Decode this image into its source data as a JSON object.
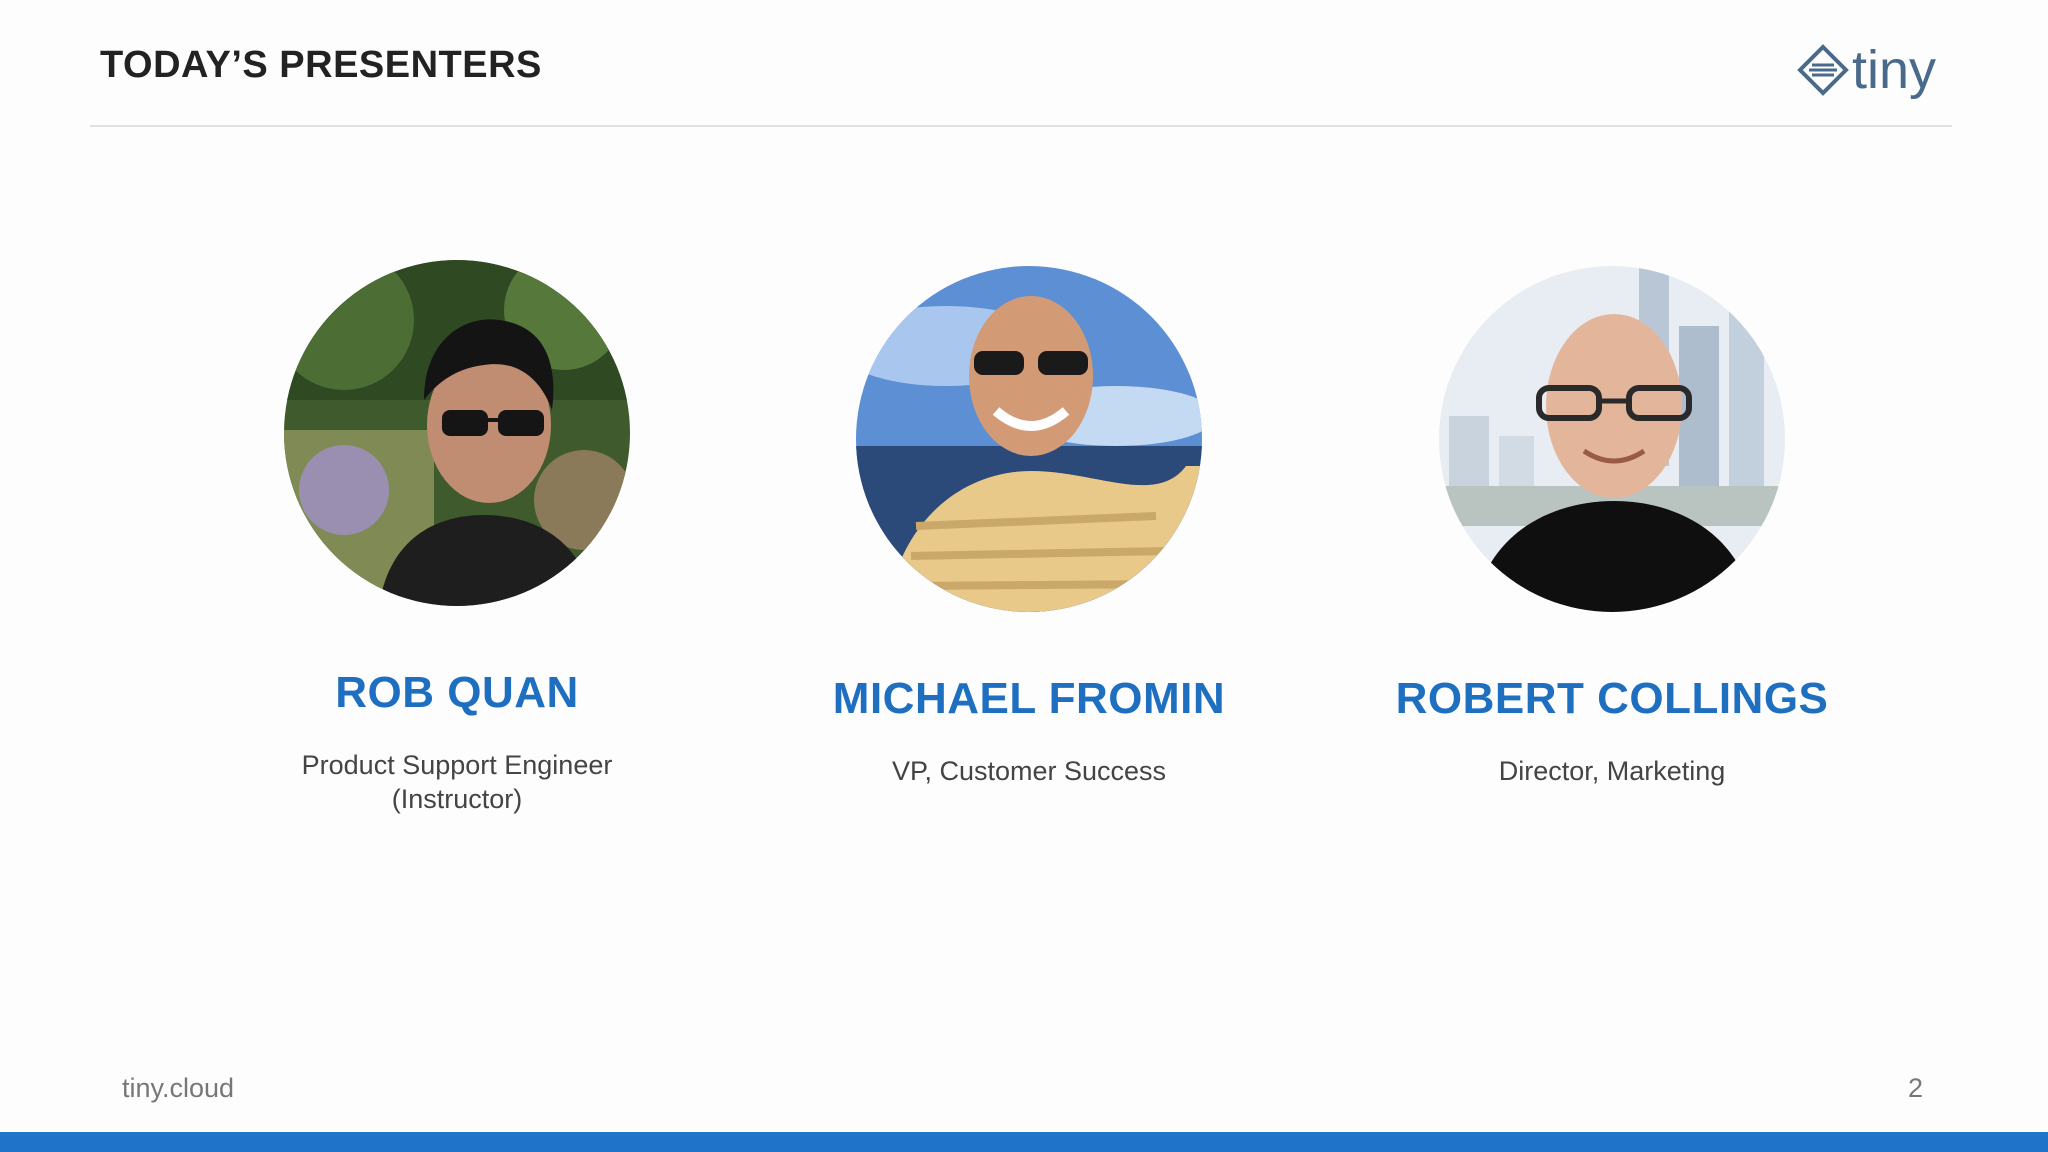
{
  "slide": {
    "title": "TODAY’S PRESENTERS",
    "logo_text": "tiny",
    "footer_url": "tiny.cloud",
    "page_number": "2"
  },
  "presenters": [
    {
      "name": "ROB QUAN",
      "role_line1": "Product Support Engineer",
      "role_line2": "(Instructor)"
    },
    {
      "name": "MICHAEL FROMIN",
      "role_line1": "VP, Customer Success",
      "role_line2": ""
    },
    {
      "name": "ROBERT COLLINGS",
      "role_line1": "Director, Marketing",
      "role_line2": ""
    }
  ],
  "colors": {
    "accent": "#1f6fc1",
    "bottom_bar": "#1f74c9",
    "title": "#222222",
    "logo": "#4a6a8c"
  }
}
